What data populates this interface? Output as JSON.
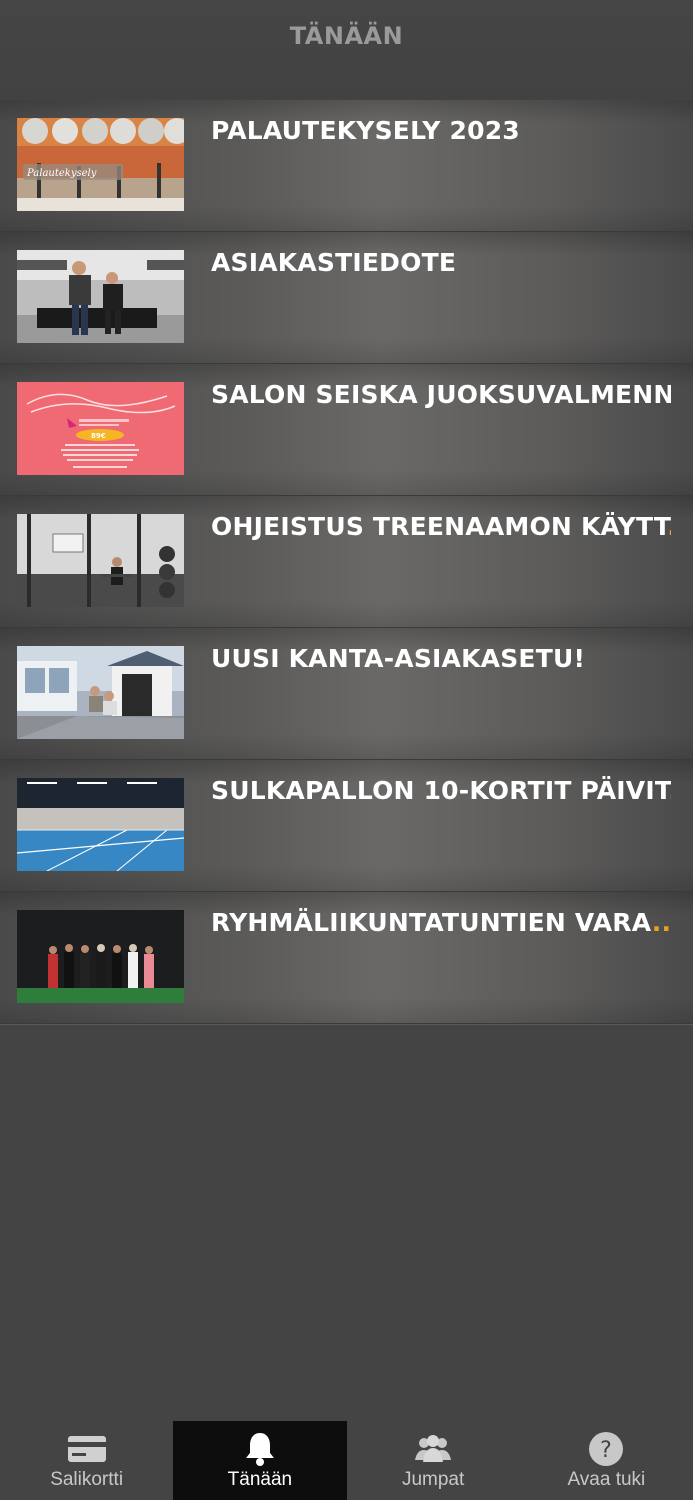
{
  "header": {
    "title": "TÄNÄÄN"
  },
  "items": [
    {
      "title": "PALAUTEKYSELY 2023",
      "ellipsis": ""
    },
    {
      "title": "ASIAKASTIEDOTE",
      "ellipsis": ""
    },
    {
      "title": "SALON SEISKA JUOKSUVALMENN",
      "ellipsis": "..."
    },
    {
      "title": "OHJEISTUS TREENAAMON KÄYTT",
      "ellipsis": "..."
    },
    {
      "title": "UUSI KANTA-ASIAKASETU!",
      "ellipsis": ""
    },
    {
      "title": "SULKAPALLON 10-KORTIT PÄIVIT",
      "ellipsis": "..."
    },
    {
      "title": "RYHMÄLIIKUNTATUNTIEN VARA",
      "ellipsis": "..."
    }
  ],
  "thumb_text": {
    "palaute": "Palautekysely",
    "price": "89€"
  },
  "tabs": [
    {
      "label": "Salikortti",
      "icon": "card-icon"
    },
    {
      "label": "Tänään",
      "icon": "bell-icon"
    },
    {
      "label": "Jumpat",
      "icon": "group-icon"
    },
    {
      "label": "Avaa tuki",
      "icon": "help-icon"
    }
  ],
  "colors": {
    "background": "#454444",
    "accent": "#e9a21f",
    "active_tab": "#0d0d0d"
  }
}
